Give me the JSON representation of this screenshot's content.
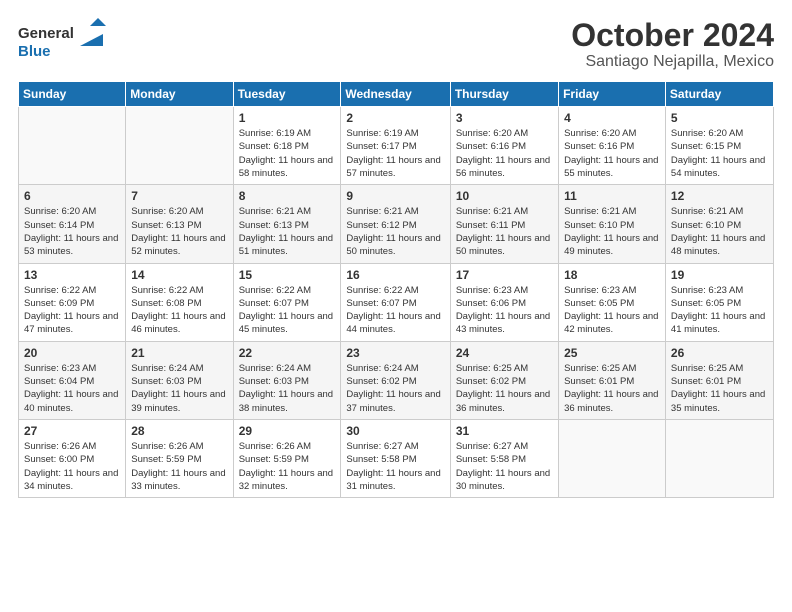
{
  "logo": {
    "line1": "General",
    "line2": "Blue",
    "icon_color": "#1a6faf"
  },
  "header": {
    "month": "October 2024",
    "location": "Santiago Nejapilla, Mexico"
  },
  "weekdays": [
    "Sunday",
    "Monday",
    "Tuesday",
    "Wednesday",
    "Thursday",
    "Friday",
    "Saturday"
  ],
  "weeks": [
    [
      {
        "day": "",
        "sunrise": "",
        "sunset": "",
        "daylight": ""
      },
      {
        "day": "",
        "sunrise": "",
        "sunset": "",
        "daylight": ""
      },
      {
        "day": "1",
        "sunrise": "Sunrise: 6:19 AM",
        "sunset": "Sunset: 6:18 PM",
        "daylight": "Daylight: 11 hours and 58 minutes."
      },
      {
        "day": "2",
        "sunrise": "Sunrise: 6:19 AM",
        "sunset": "Sunset: 6:17 PM",
        "daylight": "Daylight: 11 hours and 57 minutes."
      },
      {
        "day": "3",
        "sunrise": "Sunrise: 6:20 AM",
        "sunset": "Sunset: 6:16 PM",
        "daylight": "Daylight: 11 hours and 56 minutes."
      },
      {
        "day": "4",
        "sunrise": "Sunrise: 6:20 AM",
        "sunset": "Sunset: 6:16 PM",
        "daylight": "Daylight: 11 hours and 55 minutes."
      },
      {
        "day": "5",
        "sunrise": "Sunrise: 6:20 AM",
        "sunset": "Sunset: 6:15 PM",
        "daylight": "Daylight: 11 hours and 54 minutes."
      }
    ],
    [
      {
        "day": "6",
        "sunrise": "Sunrise: 6:20 AM",
        "sunset": "Sunset: 6:14 PM",
        "daylight": "Daylight: 11 hours and 53 minutes."
      },
      {
        "day": "7",
        "sunrise": "Sunrise: 6:20 AM",
        "sunset": "Sunset: 6:13 PM",
        "daylight": "Daylight: 11 hours and 52 minutes."
      },
      {
        "day": "8",
        "sunrise": "Sunrise: 6:21 AM",
        "sunset": "Sunset: 6:13 PM",
        "daylight": "Daylight: 11 hours and 51 minutes."
      },
      {
        "day": "9",
        "sunrise": "Sunrise: 6:21 AM",
        "sunset": "Sunset: 6:12 PM",
        "daylight": "Daylight: 11 hours and 50 minutes."
      },
      {
        "day": "10",
        "sunrise": "Sunrise: 6:21 AM",
        "sunset": "Sunset: 6:11 PM",
        "daylight": "Daylight: 11 hours and 50 minutes."
      },
      {
        "day": "11",
        "sunrise": "Sunrise: 6:21 AM",
        "sunset": "Sunset: 6:10 PM",
        "daylight": "Daylight: 11 hours and 49 minutes."
      },
      {
        "day": "12",
        "sunrise": "Sunrise: 6:21 AM",
        "sunset": "Sunset: 6:10 PM",
        "daylight": "Daylight: 11 hours and 48 minutes."
      }
    ],
    [
      {
        "day": "13",
        "sunrise": "Sunrise: 6:22 AM",
        "sunset": "Sunset: 6:09 PM",
        "daylight": "Daylight: 11 hours and 47 minutes."
      },
      {
        "day": "14",
        "sunrise": "Sunrise: 6:22 AM",
        "sunset": "Sunset: 6:08 PM",
        "daylight": "Daylight: 11 hours and 46 minutes."
      },
      {
        "day": "15",
        "sunrise": "Sunrise: 6:22 AM",
        "sunset": "Sunset: 6:07 PM",
        "daylight": "Daylight: 11 hours and 45 minutes."
      },
      {
        "day": "16",
        "sunrise": "Sunrise: 6:22 AM",
        "sunset": "Sunset: 6:07 PM",
        "daylight": "Daylight: 11 hours and 44 minutes."
      },
      {
        "day": "17",
        "sunrise": "Sunrise: 6:23 AM",
        "sunset": "Sunset: 6:06 PM",
        "daylight": "Daylight: 11 hours and 43 minutes."
      },
      {
        "day": "18",
        "sunrise": "Sunrise: 6:23 AM",
        "sunset": "Sunset: 6:05 PM",
        "daylight": "Daylight: 11 hours and 42 minutes."
      },
      {
        "day": "19",
        "sunrise": "Sunrise: 6:23 AM",
        "sunset": "Sunset: 6:05 PM",
        "daylight": "Daylight: 11 hours and 41 minutes."
      }
    ],
    [
      {
        "day": "20",
        "sunrise": "Sunrise: 6:23 AM",
        "sunset": "Sunset: 6:04 PM",
        "daylight": "Daylight: 11 hours and 40 minutes."
      },
      {
        "day": "21",
        "sunrise": "Sunrise: 6:24 AM",
        "sunset": "Sunset: 6:03 PM",
        "daylight": "Daylight: 11 hours and 39 minutes."
      },
      {
        "day": "22",
        "sunrise": "Sunrise: 6:24 AM",
        "sunset": "Sunset: 6:03 PM",
        "daylight": "Daylight: 11 hours and 38 minutes."
      },
      {
        "day": "23",
        "sunrise": "Sunrise: 6:24 AM",
        "sunset": "Sunset: 6:02 PM",
        "daylight": "Daylight: 11 hours and 37 minutes."
      },
      {
        "day": "24",
        "sunrise": "Sunrise: 6:25 AM",
        "sunset": "Sunset: 6:02 PM",
        "daylight": "Daylight: 11 hours and 36 minutes."
      },
      {
        "day": "25",
        "sunrise": "Sunrise: 6:25 AM",
        "sunset": "Sunset: 6:01 PM",
        "daylight": "Daylight: 11 hours and 36 minutes."
      },
      {
        "day": "26",
        "sunrise": "Sunrise: 6:25 AM",
        "sunset": "Sunset: 6:01 PM",
        "daylight": "Daylight: 11 hours and 35 minutes."
      }
    ],
    [
      {
        "day": "27",
        "sunrise": "Sunrise: 6:26 AM",
        "sunset": "Sunset: 6:00 PM",
        "daylight": "Daylight: 11 hours and 34 minutes."
      },
      {
        "day": "28",
        "sunrise": "Sunrise: 6:26 AM",
        "sunset": "Sunset: 5:59 PM",
        "daylight": "Daylight: 11 hours and 33 minutes."
      },
      {
        "day": "29",
        "sunrise": "Sunrise: 6:26 AM",
        "sunset": "Sunset: 5:59 PM",
        "daylight": "Daylight: 11 hours and 32 minutes."
      },
      {
        "day": "30",
        "sunrise": "Sunrise: 6:27 AM",
        "sunset": "Sunset: 5:58 PM",
        "daylight": "Daylight: 11 hours and 31 minutes."
      },
      {
        "day": "31",
        "sunrise": "Sunrise: 6:27 AM",
        "sunset": "Sunset: 5:58 PM",
        "daylight": "Daylight: 11 hours and 30 minutes."
      },
      {
        "day": "",
        "sunrise": "",
        "sunset": "",
        "daylight": ""
      },
      {
        "day": "",
        "sunrise": "",
        "sunset": "",
        "daylight": ""
      }
    ]
  ]
}
